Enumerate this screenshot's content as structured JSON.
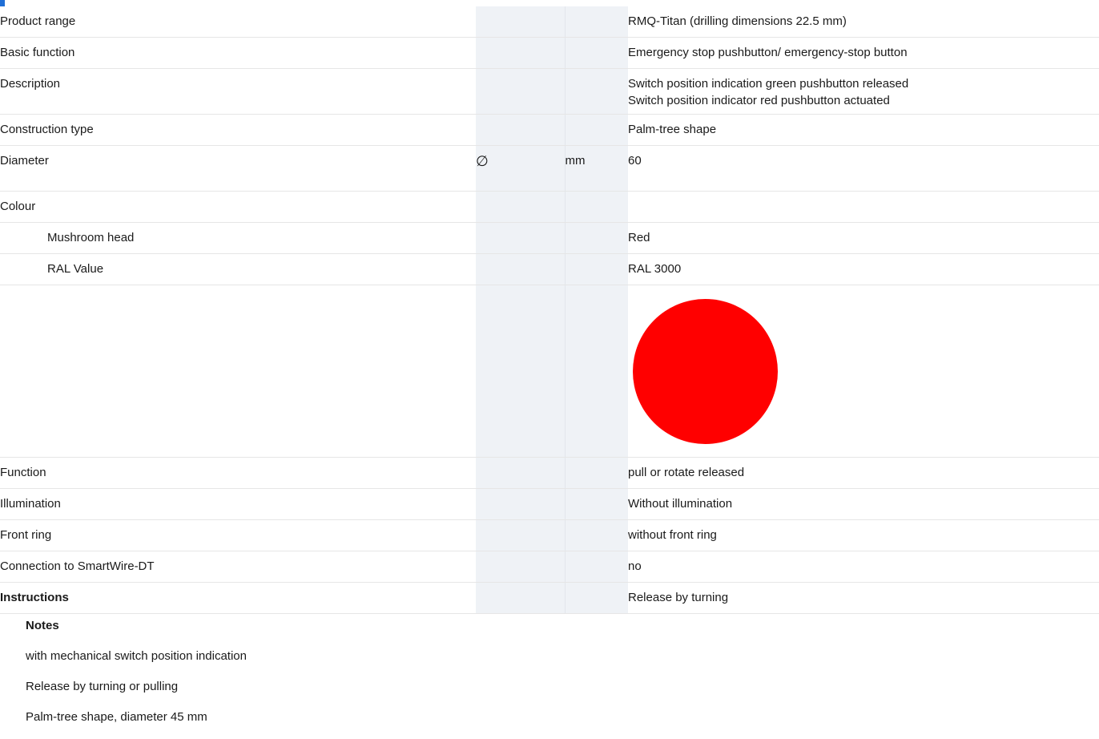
{
  "rows": [
    {
      "label": "Product range",
      "symbol": "",
      "unit": "",
      "values": [
        "RMQ-Titan (drilling dimensions 22.5 mm)"
      ]
    },
    {
      "label": "Basic function",
      "symbol": "",
      "unit": "",
      "values": [
        "Emergency stop pushbutton/ emergency-stop button"
      ]
    },
    {
      "label": "Description",
      "symbol": "",
      "unit": "",
      "values": [
        "Switch position indication green pushbutton released",
        "Switch position indicator red pushbutton actuated"
      ]
    },
    {
      "label": "Construction type",
      "symbol": "",
      "unit": "",
      "values": [
        "Palm-tree shape"
      ]
    },
    {
      "label": "Diameter",
      "symbol": "∅",
      "unit": "mm",
      "values": [
        "60"
      ]
    },
    {
      "label": "Colour",
      "symbol": "",
      "unit": "",
      "values": [
        ""
      ]
    },
    {
      "label": "Mushroom head",
      "symbol": "",
      "unit": "",
      "values": [
        "Red"
      ]
    },
    {
      "label": "RAL Value",
      "symbol": "",
      "unit": "",
      "values": [
        "RAL 3000"
      ]
    },
    {
      "label": "Function",
      "symbol": "",
      "unit": "",
      "values": [
        "pull or rotate released"
      ]
    },
    {
      "label": "Illumination",
      "symbol": "",
      "unit": "",
      "values": [
        "Without illumination"
      ]
    },
    {
      "label": "Front ring",
      "symbol": "",
      "unit": "",
      "values": [
        "without front ring"
      ]
    },
    {
      "label": "Connection to SmartWire-DT",
      "symbol": "",
      "unit": "",
      "values": [
        "no"
      ]
    },
    {
      "label": "Instructions",
      "symbol": "",
      "unit": "",
      "values": [
        "Release by turning"
      ]
    }
  ],
  "colour_swatch": "#ff0000",
  "notes": {
    "heading": "Notes",
    "items": [
      "with mechanical switch position indication",
      "Release by turning or pulling",
      "Palm-tree shape, diameter 45 mm"
    ]
  }
}
